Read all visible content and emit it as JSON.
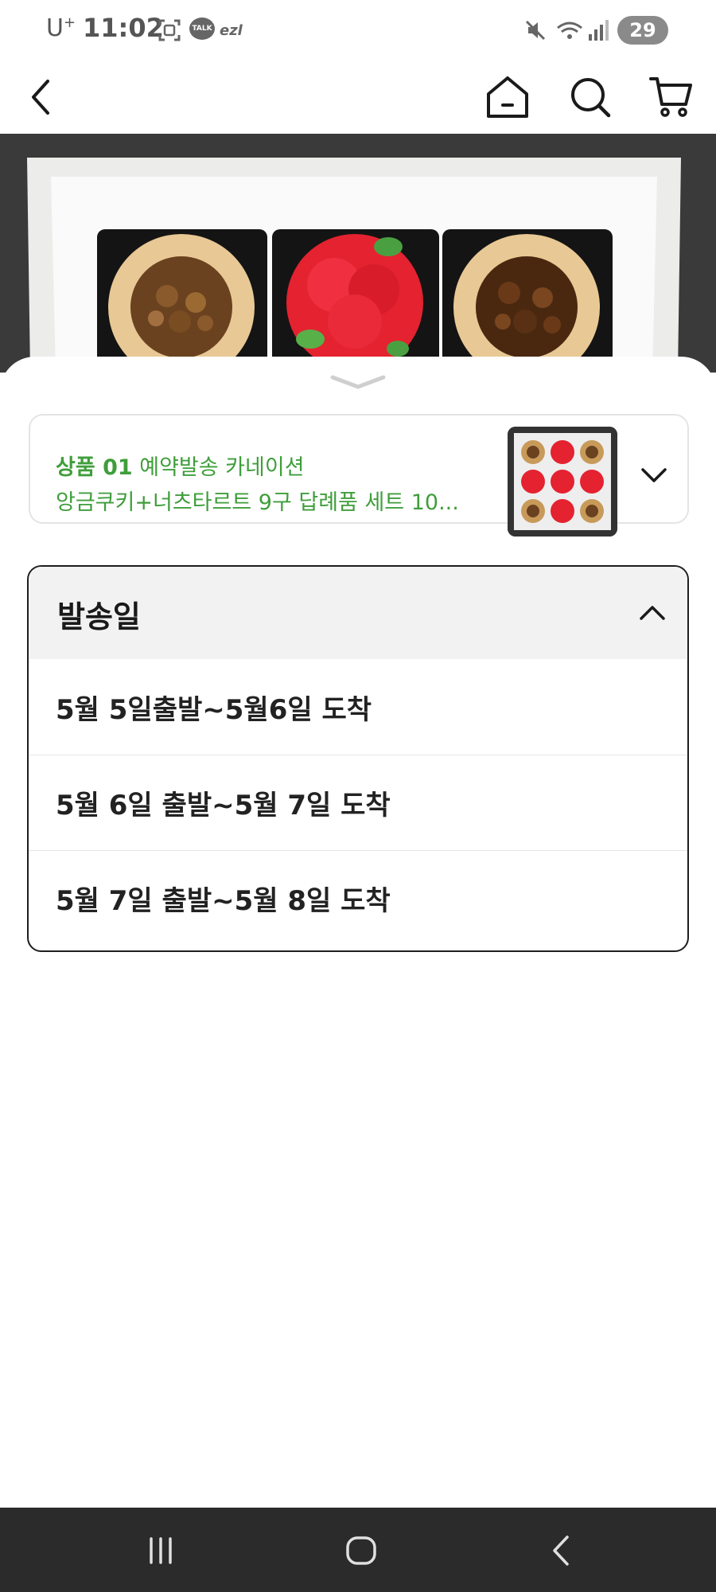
{
  "status_bar": {
    "carrier": "U",
    "carrier_sup": "+",
    "time": "11:02",
    "talk_badge": "TALK",
    "ezl_badge": "ezl",
    "battery": "29",
    "icons": [
      "screenshot-icon",
      "talk-icon",
      "ezl-icon",
      "mute-icon",
      "wifi-icon",
      "signal-icon",
      "battery-icon"
    ]
  },
  "nav": {
    "icons": [
      "back-icon",
      "home-icon",
      "search-icon",
      "cart-icon"
    ]
  },
  "sheet": {
    "product": {
      "label": "상품 01",
      "name_line1": " 예약발송 카네이션",
      "name_line2": "앙금쿠키+너츠타르트 9구 답례품 세트 10..."
    },
    "dropdown": {
      "title": "발송일",
      "options": [
        "5월 5일출발~5월6일 도착",
        "5월 6일 출발~5월 7일 도착",
        "5월 7일 출발~5월 8일 도착"
      ]
    }
  },
  "colors": {
    "accent_green": "#3f9e3b",
    "border_dark": "#1e1e1e",
    "header_bg": "#f2f2f2",
    "android_nav_bg": "#2b2b2b"
  }
}
